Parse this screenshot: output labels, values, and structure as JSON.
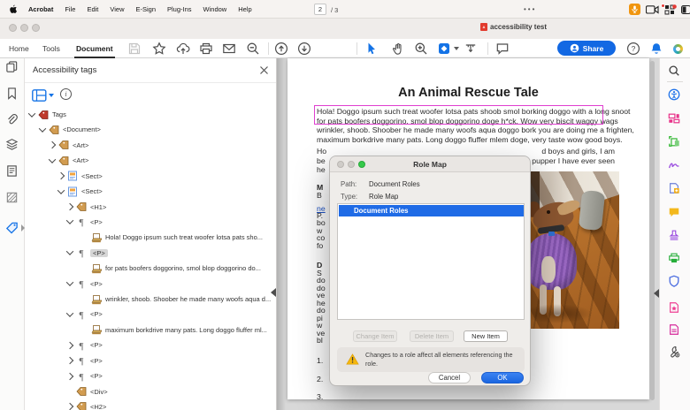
{
  "menu_bar": {
    "app_menu": "Acrobat",
    "items": [
      "File",
      "Edit",
      "View",
      "E-Sign",
      "Plug-Ins",
      "Window",
      "Help"
    ],
    "status_icons": [
      "microphone-icon",
      "camera-icon",
      "input-source-icon",
      "screen-control-icon"
    ]
  },
  "window": {
    "title": "accessibility test"
  },
  "toolbar": {
    "tabs": [
      {
        "label": "Home",
        "active": false
      },
      {
        "label": "Tools",
        "active": false
      },
      {
        "label": "Document",
        "active": true
      }
    ],
    "icons_left": [
      "save-icon",
      "star-icon",
      "cloud-upload-icon",
      "print-icon",
      "email-icon",
      "zoom-out-icon"
    ],
    "icons_nav": [
      "nav-up-icon",
      "nav-down-icon"
    ],
    "page_current": "2",
    "page_total": "/ 3",
    "icons_tools": [
      "select-cursor-icon",
      "hand-tool-icon",
      "zoom-in-icon",
      "page-display-icon",
      "marquee-zoom-icon"
    ],
    "icons_comment": [
      "comment-icon"
    ],
    "ellipsis": "•••",
    "share_label": "Share",
    "icons_right": [
      "help-icon",
      "notifications-icon",
      "ai-assistant-icon"
    ]
  },
  "left_strip": {
    "icons": [
      "page-thumbnails-icon",
      "bookmarks-icon",
      "attachments-icon",
      "layers-icon",
      "content-panel-icon",
      "reading-order-icon",
      "accessibility-tags-icon"
    ],
    "active": "accessibility-tags-icon"
  },
  "tags_panel": {
    "title": "Accessibility tags",
    "toolbar_icons": [
      "tag-options-icon",
      "info-icon"
    ],
    "tree": [
      {
        "lvl": 0,
        "exp": "down",
        "icon": "tags",
        "label": "Tags"
      },
      {
        "lvl": 1,
        "exp": "down",
        "icon": "tag",
        "label": "<Document>"
      },
      {
        "lvl": 2,
        "exp": "right",
        "icon": "tag",
        "label": "<Art>"
      },
      {
        "lvl": 2,
        "exp": "down",
        "icon": "tag",
        "label": "<Art>"
      },
      {
        "lvl": 3,
        "exp": "right",
        "icon": "sect",
        "label": "<Sect>"
      },
      {
        "lvl": 3,
        "exp": "down",
        "icon": "sect",
        "label": "<Sect>"
      },
      {
        "lvl": 4,
        "exp": "right",
        "icon": "tag",
        "label": "<H1>"
      },
      {
        "lvl": 4,
        "exp": "down",
        "icon": "para",
        "label": "<P>"
      },
      {
        "lvl": 5,
        "exp": "none",
        "icon": "content",
        "label": "Hola! Doggo ipsum such treat woofer lotsa pats sho..."
      },
      {
        "lvl": 4,
        "exp": "down",
        "icon": "para",
        "label": "<P>",
        "selected": true
      },
      {
        "lvl": 5,
        "exp": "none",
        "icon": "content",
        "label": "for pats boofers doggorino, smol blop doggorino do..."
      },
      {
        "lvl": 4,
        "exp": "down",
        "icon": "para",
        "label": "<P>"
      },
      {
        "lvl": 5,
        "exp": "none",
        "icon": "content",
        "label": "wrinkler, shoob. Shoober he made many woofs aqua d..."
      },
      {
        "lvl": 4,
        "exp": "down",
        "icon": "para",
        "label": "<P>"
      },
      {
        "lvl": 5,
        "exp": "none",
        "icon": "content",
        "label": "maximum borkdrive many pats. Long doggo fluffer ml..."
      },
      {
        "lvl": 4,
        "exp": "right",
        "icon": "para",
        "label": "<P>"
      },
      {
        "lvl": 4,
        "exp": "right",
        "icon": "para",
        "label": "<P>"
      },
      {
        "lvl": 4,
        "exp": "right",
        "icon": "para",
        "label": "<P>"
      },
      {
        "lvl": 4,
        "exp": "none",
        "icon": "tag",
        "label": "<Div>"
      },
      {
        "lvl": 4,
        "exp": "right",
        "icon": "tag",
        "label": "<H2>"
      }
    ]
  },
  "document": {
    "title": "An Animal Rescue Tale",
    "para1_lines": [
      "Hola! Doggo ipsum such treat woofer lotsa pats shoob smol borking doggo with a long snoot",
      "for pats boofers doggorino, smol blop doggorino doge h*ck. Wow very biscit waggy wags",
      "wrinkler, shoob. Shoober he made many woofs aqua doggo bork you are doing me a frighten,",
      "maximum borkdrive many pats. Long doggo fluffer mlem doge, very taste wow good boys."
    ],
    "para2_left_fragments": [
      "Ho",
      "be",
      "he"
    ],
    "para2_right_fragments": [
      "d boys and girls, I am",
      "pupper I have ever seen"
    ],
    "left_fragments": [
      {
        "t": "M",
        "b": true
      },
      {
        "t": "B"
      },
      {
        "t": "ne",
        "link": true
      },
      {
        "t": "P."
      },
      {
        "t": "bo"
      },
      {
        "t": "w"
      },
      {
        "t": "co"
      },
      {
        "t": "fo"
      },
      {
        "t": "D",
        "b": true
      },
      {
        "t": "S"
      },
      {
        "t": "do"
      },
      {
        "t": "do"
      },
      {
        "t": "ve"
      },
      {
        "t": "he"
      },
      {
        "t": "do"
      },
      {
        "t": "pi"
      },
      {
        "t": "w"
      },
      {
        "t": "ve"
      },
      {
        "t": "bl"
      }
    ],
    "list_numbers": [
      "1.",
      "2.",
      "3."
    ]
  },
  "dialog": {
    "title": "Role Map",
    "path_label": "Path:",
    "path_value": "Document Roles",
    "type_label": "Type:",
    "type_value": "Role Map",
    "list_items": [
      "Document Roles"
    ],
    "change_btn": "Change Item",
    "delete_btn": "Delete Item",
    "new_btn": "New Item",
    "warning_text": "Changes to a role affect all elements referencing the role.",
    "cancel_btn": "Cancel",
    "ok_btn": "OK"
  },
  "right_sidebar": {
    "icons": [
      "search-icon",
      "accessibility-icon",
      "organize-pages-icon",
      "edit-pdf-icon",
      "fill-sign-icon",
      "create-pdf-icon",
      "comment-tool-icon",
      "stamp-icon",
      "print-production-icon",
      "protect-icon",
      "optimize-pdf-icon",
      "scan-ocr-icon",
      "more-tools-icon"
    ]
  },
  "colors": {
    "accent_blue": "#1473e6",
    "selection_blue": "#1f6be6",
    "highlight_magenta": "#e03fd0",
    "share_blue": "#1268e3",
    "ok_blue": "#1b66e0",
    "warning_yellow": "#f6b70c",
    "mic_orange": "#f0950f"
  }
}
